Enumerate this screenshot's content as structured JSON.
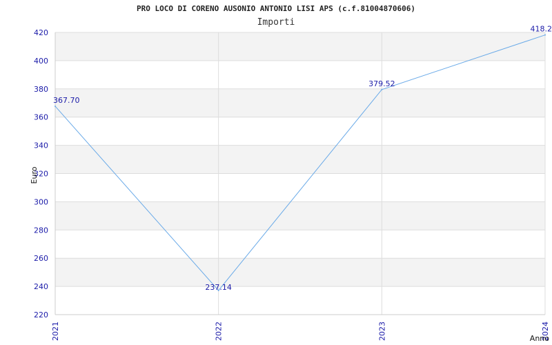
{
  "chart_data": {
    "type": "line",
    "title": "PRO LOCO DI CORENO AUSONIO ANTONIO LISI APS (c.f.81004870606)",
    "subtitle": "Importi",
    "xlabel": "Anno",
    "ylabel": "Euro",
    "categories": [
      "2021",
      "2022",
      "2023",
      "2024"
    ],
    "series": [
      {
        "values": [
          367.7,
          237.14,
          379.52,
          418.2
        ],
        "labels": [
          "367.70",
          "237.14",
          "379.52",
          "418.2"
        ],
        "color": "#6aaae8"
      }
    ],
    "ylim": [
      220,
      420
    ],
    "yticks": [
      220,
      240,
      260,
      280,
      300,
      320,
      340,
      360,
      380,
      400,
      420
    ],
    "grid": true,
    "band_colors": [
      "#f3f3f3",
      "#ffffff"
    ],
    "tick_color": "#1a1aa8"
  }
}
